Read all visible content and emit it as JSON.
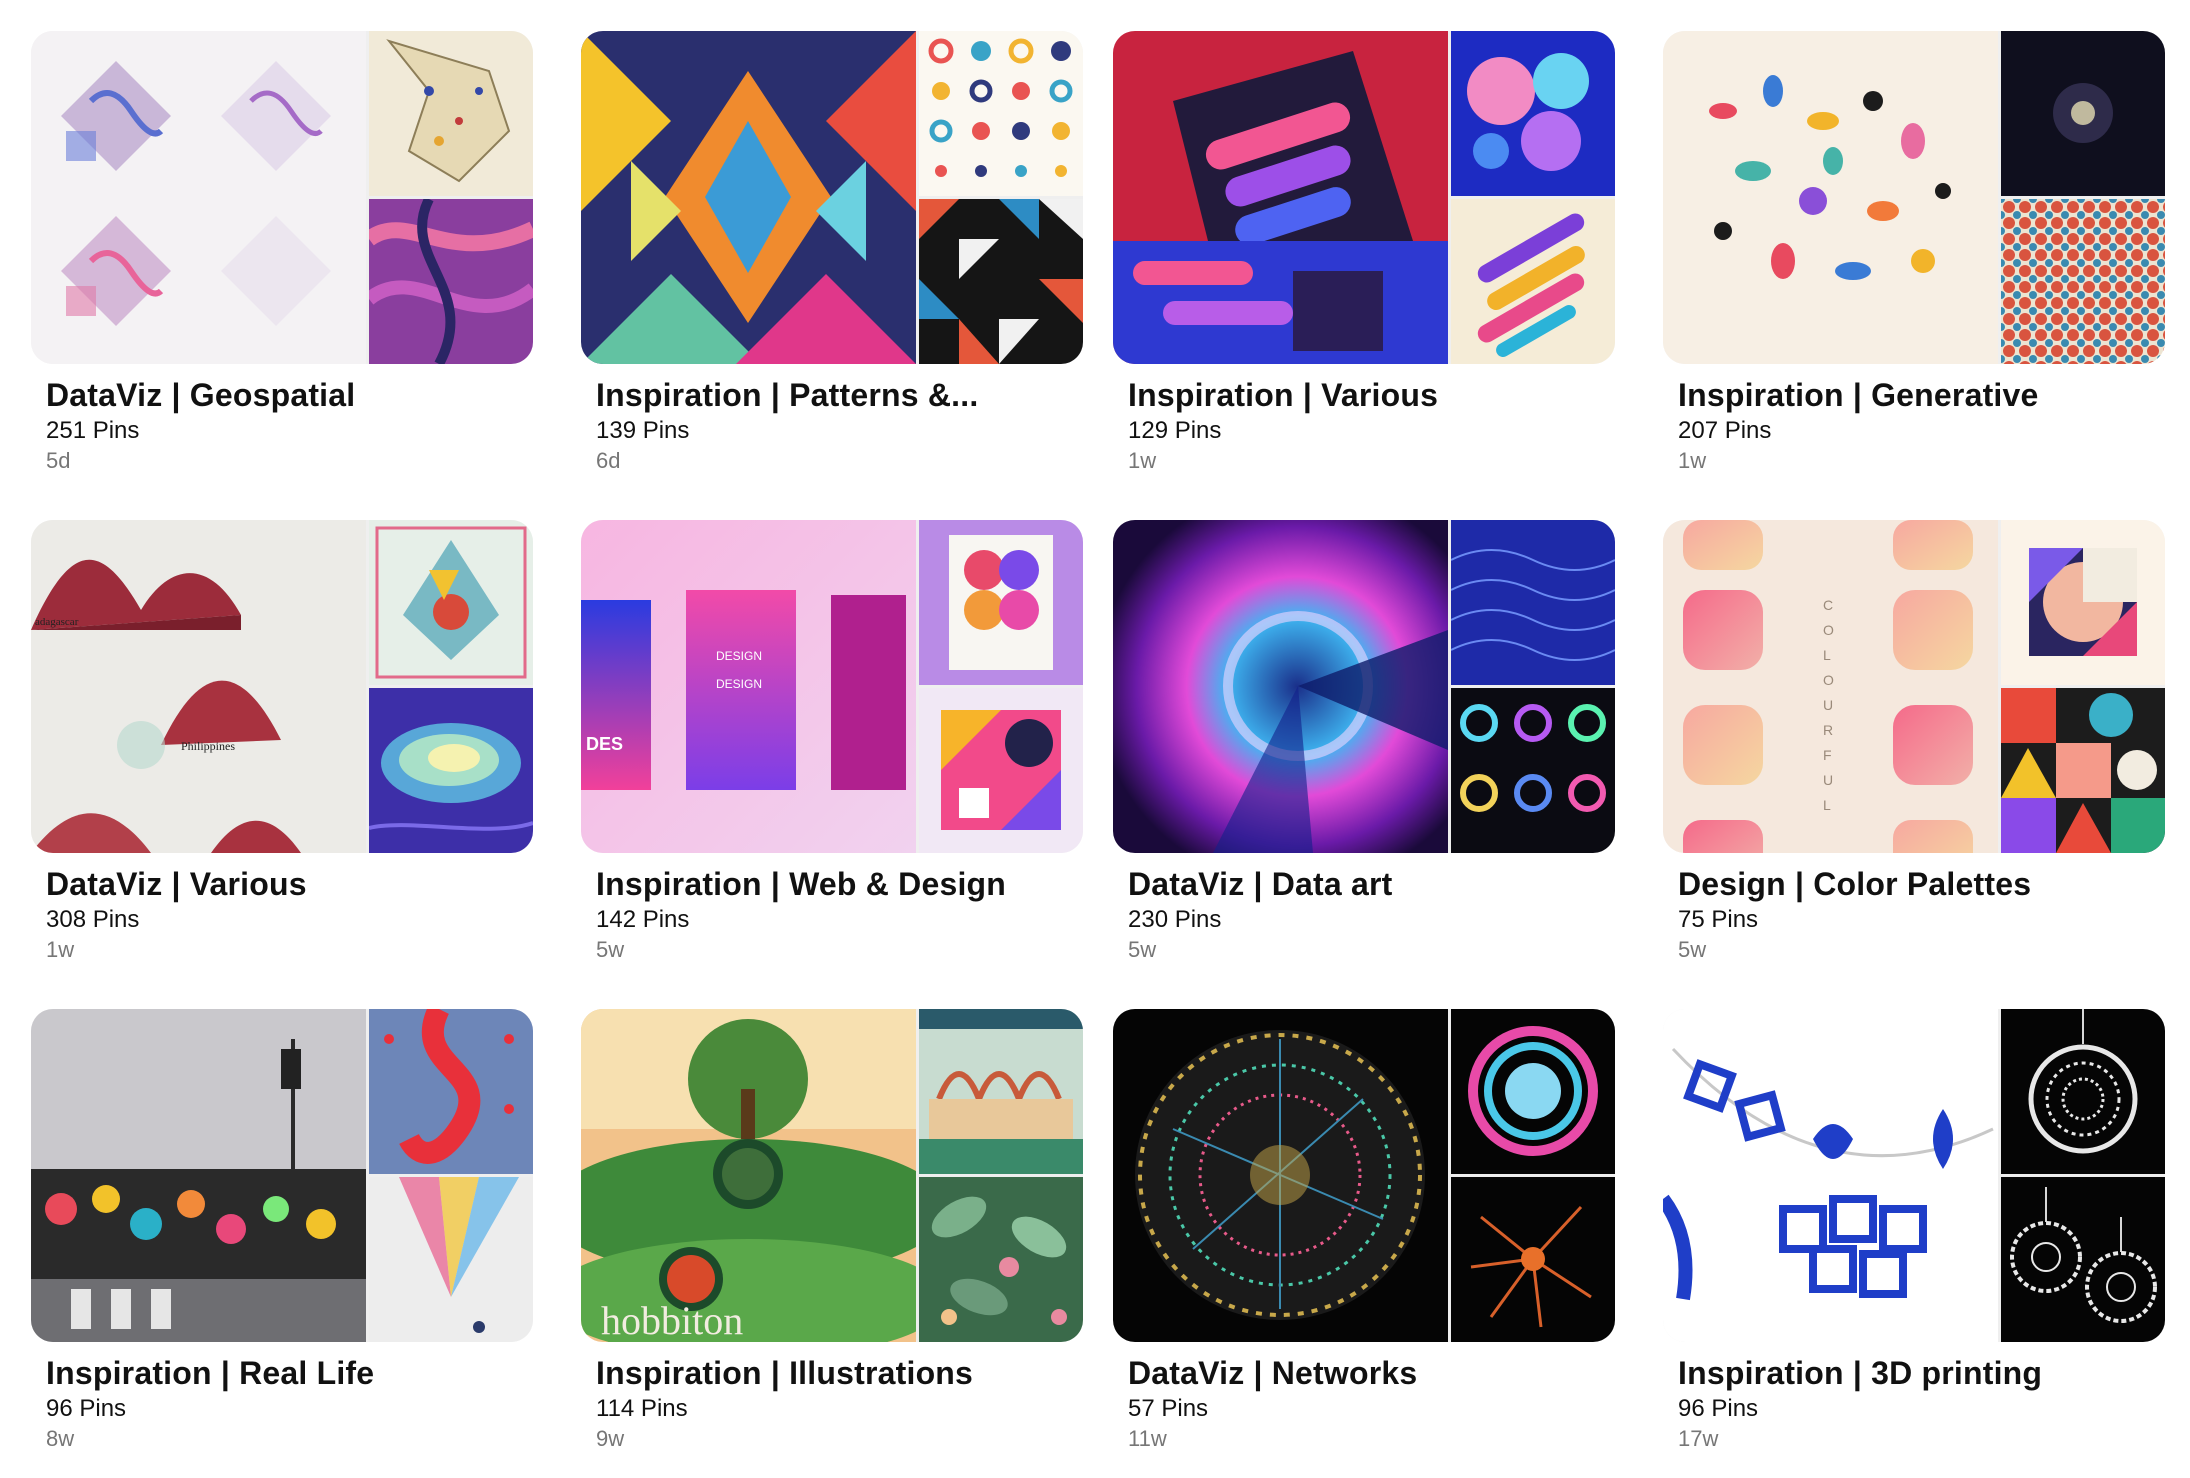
{
  "boards": [
    {
      "title": "DataViz | Geospatial",
      "pins": "251 Pins",
      "age": "5d"
    },
    {
      "title": "Inspiration | Patterns &...",
      "pins": "139 Pins",
      "age": "6d"
    },
    {
      "title": "Inspiration | Various",
      "pins": "129 Pins",
      "age": "1w"
    },
    {
      "title": "Inspiration | Generative",
      "pins": "207 Pins",
      "age": "1w"
    },
    {
      "title": "DataViz | Various",
      "pins": "308 Pins",
      "age": "1w"
    },
    {
      "title": "Inspiration | Web & Design",
      "pins": "142 Pins",
      "age": "5w"
    },
    {
      "title": "DataViz | Data art",
      "pins": "230 Pins",
      "age": "5w"
    },
    {
      "title": "Design | Color Palettes",
      "pins": "75 Pins",
      "age": "5w"
    },
    {
      "title": "Inspiration | Real Life",
      "pins": "96 Pins",
      "age": "8w"
    },
    {
      "title": "Inspiration | Illustrations",
      "pins": "114 Pins",
      "age": "9w"
    },
    {
      "title": "DataViz | Networks",
      "pins": "57 Pins",
      "age": "11w"
    },
    {
      "title": "Inspiration | 3D printing",
      "pins": "96 Pins",
      "age": "17w"
    }
  ],
  "colors": {
    "title_text": "#111111",
    "meta_text": "#767676",
    "cover_gap": "#ffffff"
  }
}
